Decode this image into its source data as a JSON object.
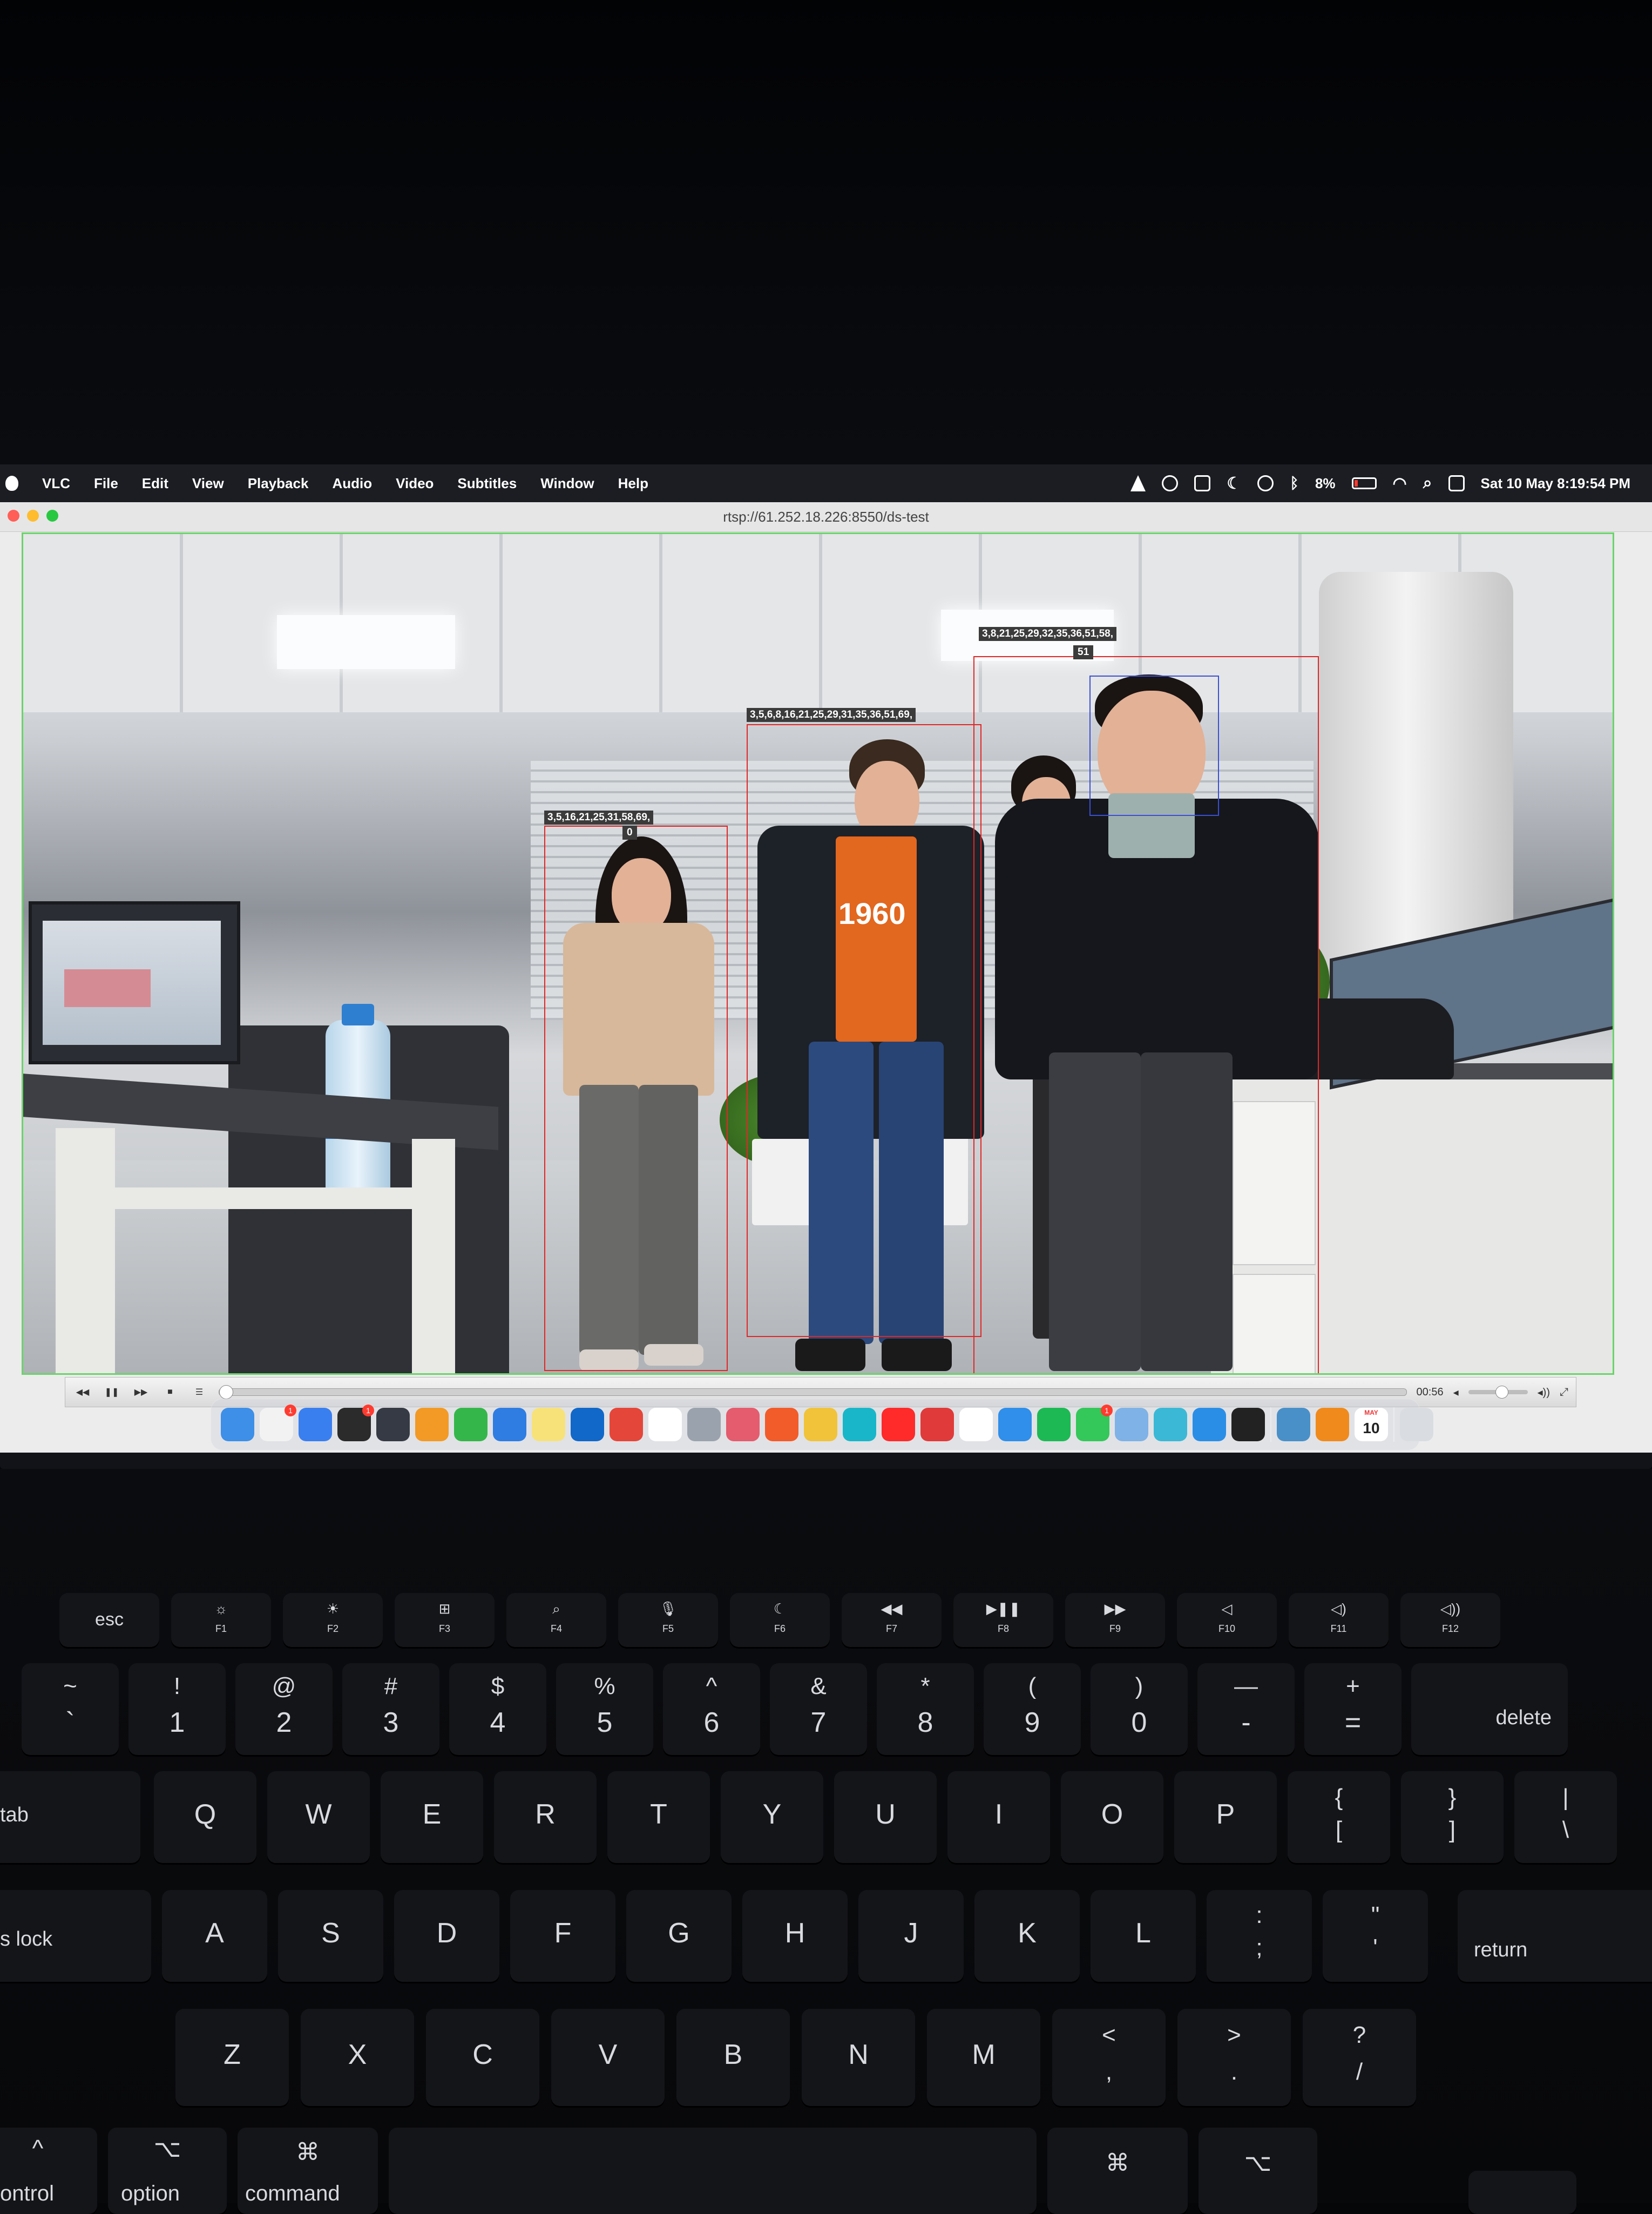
{
  "menubar": {
    "app_name": "VLC",
    "menus": [
      "File",
      "Edit",
      "View",
      "Playback",
      "Audio",
      "Video",
      "Subtitles",
      "Window",
      "Help"
    ],
    "status": {
      "battery": "8%",
      "datetime": "Sat 10 May  8:19:54 PM"
    }
  },
  "window": {
    "title": "rtsp://61.252.18.226:8550/ds-test"
  },
  "detections": [
    {
      "label": "3,5,16,21,25,31,58,69,",
      "id": "0"
    },
    {
      "label": "3,5,6,8,16,21,25,29,31,35,36,51,69,",
      "id": ""
    },
    {
      "label": "3,8,21,25,29,32,35,36,51,58,",
      "id": "51"
    }
  ],
  "video_text": {
    "shirt": "1960"
  },
  "controls": {
    "elapsed": "00:56"
  },
  "dock": {
    "apps": [
      "finder",
      "reminders",
      "mail",
      "chatgpt-desktop",
      "davinci-resolve",
      "pages",
      "numbers",
      "keynote",
      "notes",
      "outlook",
      "todoist",
      "openai",
      "screenshot",
      "affinity",
      "brave",
      "chrome",
      "canva",
      "youtube",
      "davinci",
      "notion",
      "safari",
      "spotify",
      "whatsapp",
      "preview",
      "arc",
      "vscode",
      "terminal",
      "quicktime",
      "vlc",
      "calendar",
      "trash"
    ],
    "badges": {
      "reminders": "1",
      "chatgpt-desktop": "1",
      "whatsapp": "1"
    },
    "calendar": {
      "month": "MAY",
      "day": "10"
    },
    "colors": {
      "finder": "#3d8fe8",
      "reminders": "#f2f2f2",
      "mail": "#3a7ff0",
      "chatgpt-desktop": "#2b2b2b",
      "davinci-resolve": "#363a44",
      "pages": "#f29a25",
      "numbers": "#35b64a",
      "keynote": "#2f7de2",
      "notes": "#f7e27a",
      "outlook": "#1168c9",
      "todoist": "#e5463a",
      "openai": "#ffffff",
      "screenshot": "#9aa3ad",
      "affinity": "#e45c6d",
      "brave": "#f25b2a",
      "chrome": "#f0c33a",
      "canva": "#19b6c9",
      "youtube": "#ff2a2a",
      "davinci": "#e03a3a",
      "notion": "#ffffff",
      "safari": "#2f8fea",
      "spotify": "#1db954",
      "whatsapp": "#34c759",
      "preview": "#7fb2e6",
      "arc": "#3bb8d6",
      "vscode": "#2b8ee6",
      "terminal": "#222222",
      "quicktime": "#4a90c8",
      "vlc": "#f08a1c",
      "calendar": "#ffffff",
      "trash": "#d9dde2"
    }
  },
  "keyboard": {
    "fn_row": [
      {
        "sym": "esc",
        "fn": ""
      },
      {
        "sym": "☼",
        "fn": "F1"
      },
      {
        "sym": "☀",
        "fn": "F2"
      },
      {
        "sym": "⊞",
        "fn": "F3"
      },
      {
        "sym": "⌕",
        "fn": "F4"
      },
      {
        "sym": "🎙",
        "fn": "F5"
      },
      {
        "sym": "☾",
        "fn": "F6"
      },
      {
        "sym": "◀◀",
        "fn": "F7"
      },
      {
        "sym": "▶❚❚",
        "fn": "F8"
      },
      {
        "sym": "▶▶",
        "fn": "F9"
      },
      {
        "sym": "◁",
        "fn": "F10"
      },
      {
        "sym": "◁)",
        "fn": "F11"
      },
      {
        "sym": "◁))",
        "fn": "F12"
      }
    ],
    "number_row": [
      {
        "top": "~",
        "bottom": "`"
      },
      {
        "top": "!",
        "bottom": "1"
      },
      {
        "top": "@",
        "bottom": "2"
      },
      {
        "top": "#",
        "bottom": "3"
      },
      {
        "top": "$",
        "bottom": "4"
      },
      {
        "top": "%",
        "bottom": "5"
      },
      {
        "top": "^",
        "bottom": "6"
      },
      {
        "top": "&",
        "bottom": "7"
      },
      {
        "top": "*",
        "bottom": "8"
      },
      {
        "top": "(",
        "bottom": "9"
      },
      {
        "top": ")",
        "bottom": "0"
      },
      {
        "top": "—",
        "bottom": "-"
      },
      {
        "top": "+",
        "bottom": "="
      }
    ],
    "delete_label": "delete",
    "tab_label": "tab",
    "qwerty_row": [
      "Q",
      "W",
      "E",
      "R",
      "T",
      "Y",
      "U",
      "I",
      "O",
      "P"
    ],
    "bracket_keys": [
      {
        "top": "{",
        "bottom": "["
      },
      {
        "top": "}",
        "bottom": "]"
      },
      {
        "top": "|",
        "bottom": "\\"
      }
    ],
    "caps_label": "s lock",
    "home_row": [
      "A",
      "S",
      "D",
      "F",
      "G",
      "H",
      "J",
      "K",
      "L"
    ],
    "home_punct": [
      {
        "top": ":",
        "bottom": ";"
      },
      {
        "top": "\"",
        "bottom": "'"
      }
    ],
    "return_label": "return",
    "bottom_row": [
      "Z",
      "X",
      "C",
      "V",
      "B",
      "N",
      "M"
    ],
    "bottom_punct": [
      {
        "top": "<",
        "bottom": ","
      },
      {
        "top": ">",
        "bottom": "."
      },
      {
        "top": "?",
        "bottom": "/"
      }
    ],
    "modifiers": {
      "control": "ontrol",
      "option": "option",
      "command": "command",
      "option_sym": "⌥",
      "command_sym": "⌘",
      "control_sym": "^"
    }
  }
}
